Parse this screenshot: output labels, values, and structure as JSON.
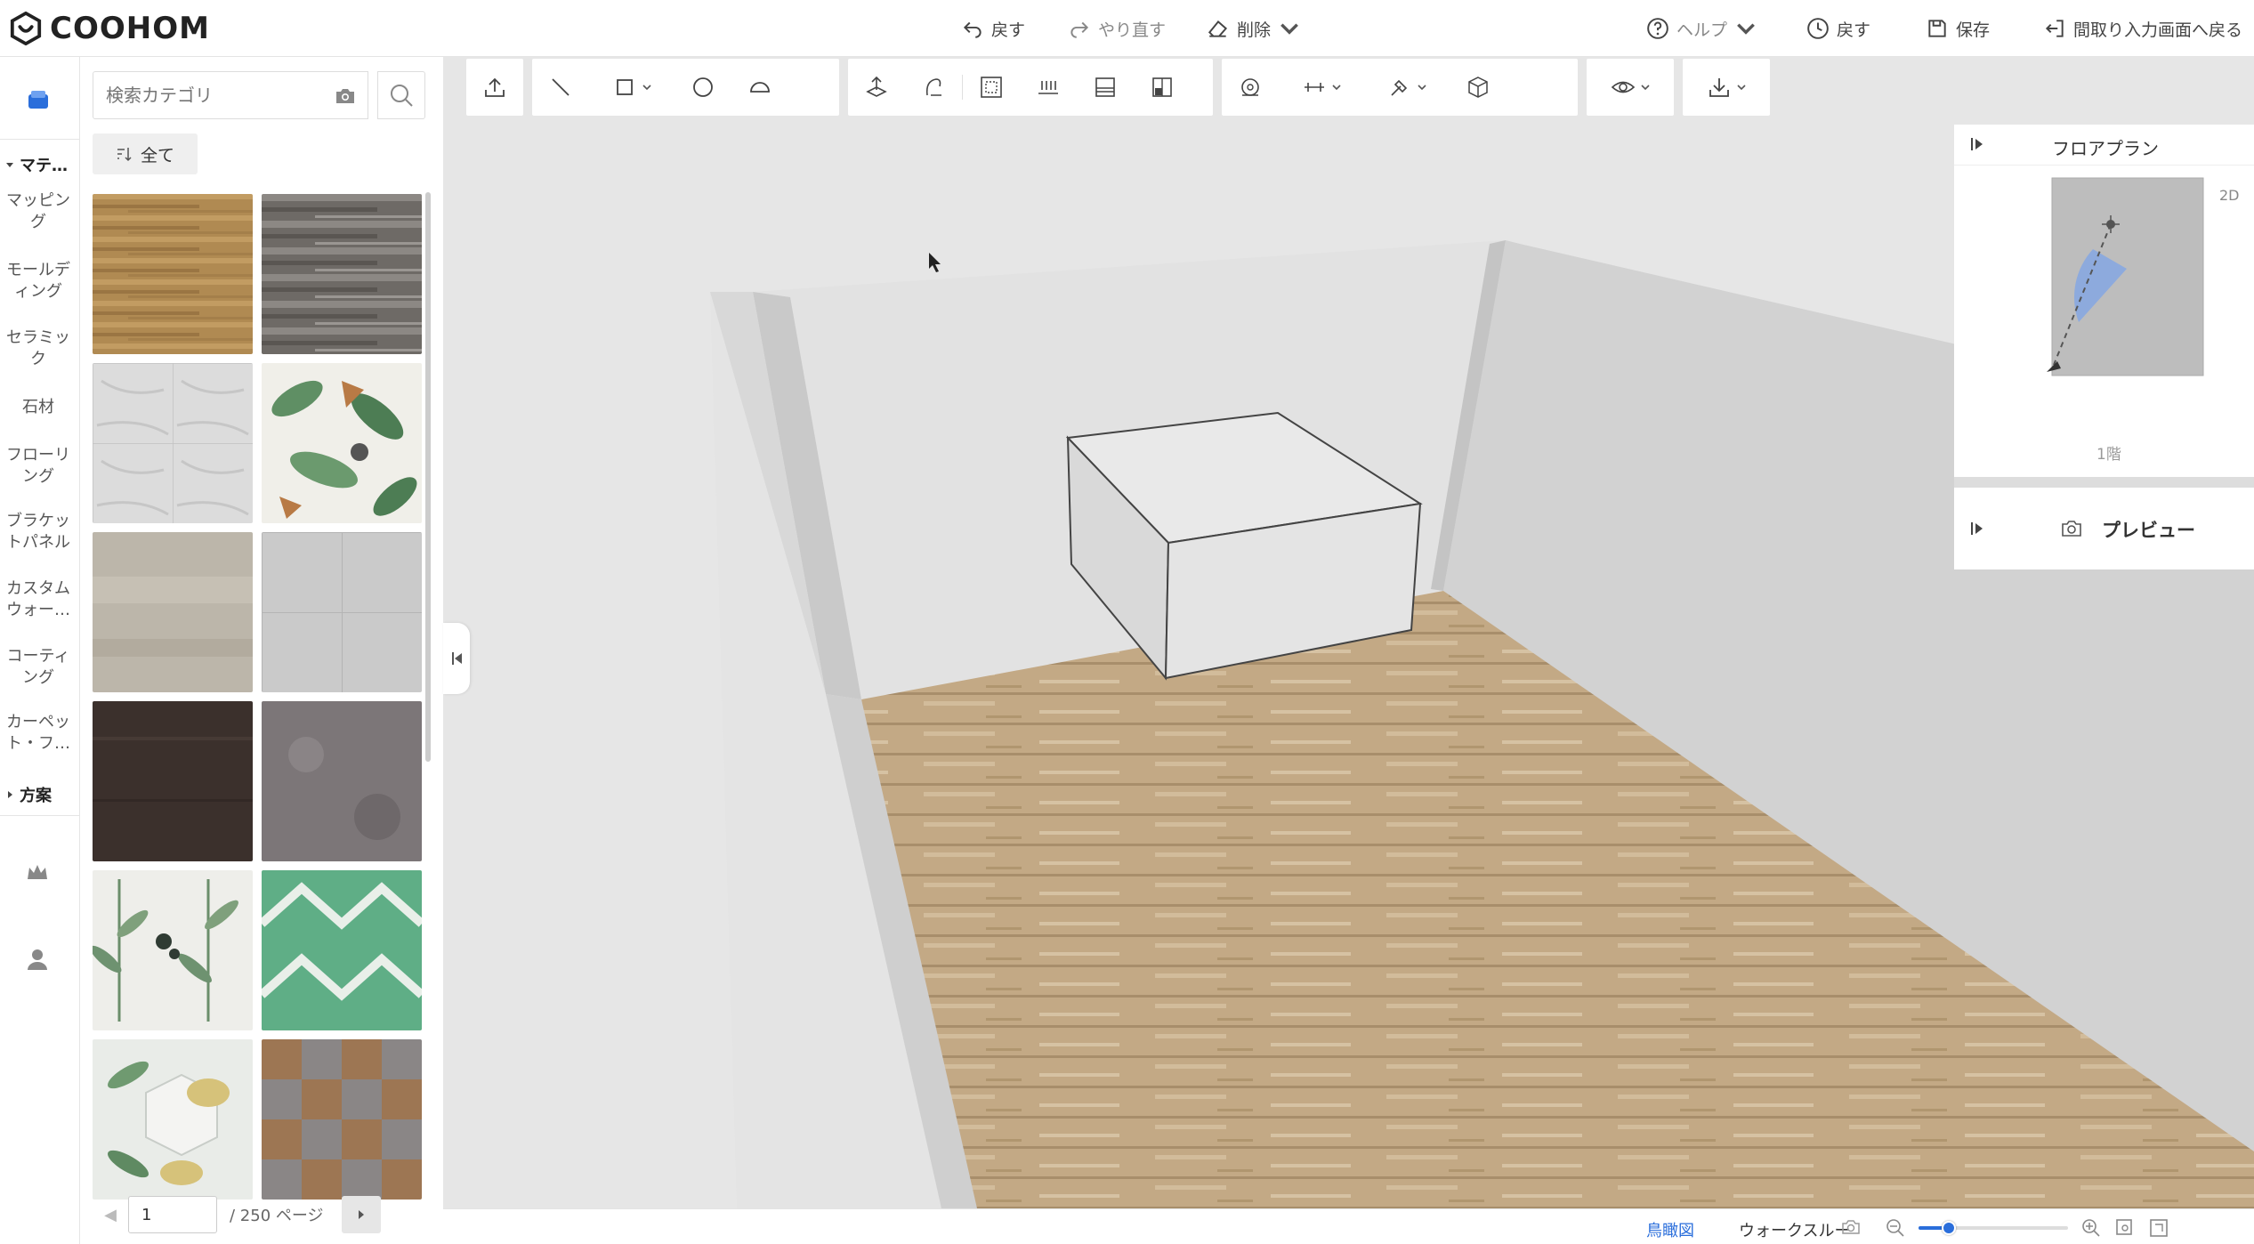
{
  "app": {
    "logo_text": "COOHOM"
  },
  "topbar": {
    "undo_label": "戻す",
    "redo_label": "やり直す",
    "delete_label": "削除",
    "help_label": "ヘルプ",
    "history_label": "戻す",
    "save_label": "保存",
    "back_label": "間取り入力画面へ戻る"
  },
  "rail": {
    "section_materials": "マテ…",
    "items": [
      "マッピング",
      "モールディング",
      "セラミック",
      "石材",
      "フローリング",
      "ブラケットパネル",
      "カスタムウォー…",
      "コーティング",
      "カーペット・フ…"
    ],
    "section_plans": "方案"
  },
  "catalog": {
    "search_placeholder": "検索カテゴリ",
    "filter_label": "全て",
    "tiles": [
      "wood-oak",
      "wood-grey",
      "marble-white",
      "tropical-leaves",
      "concrete-beige",
      "tile-grey",
      "wood-dark",
      "stone-grey",
      "leaves-white",
      "geometric-green",
      "floral-hex",
      "carpet-check"
    ],
    "page_value": "1",
    "page_total": "/ 250 ページ"
  },
  "floorplan": {
    "title": "フロアプラン",
    "mode": "2D",
    "floor": "1階"
  },
  "preview": {
    "title": "プレビュー"
  },
  "bottombar": {
    "tab_aerial": "鳥瞰図",
    "tab_walkthrough": "ウォークスルー"
  },
  "zoom": {
    "level": 0.2
  },
  "colors": {
    "accent": "#2a6edb",
    "floor": "#c2a883",
    "wall": "#e3e3e3"
  }
}
